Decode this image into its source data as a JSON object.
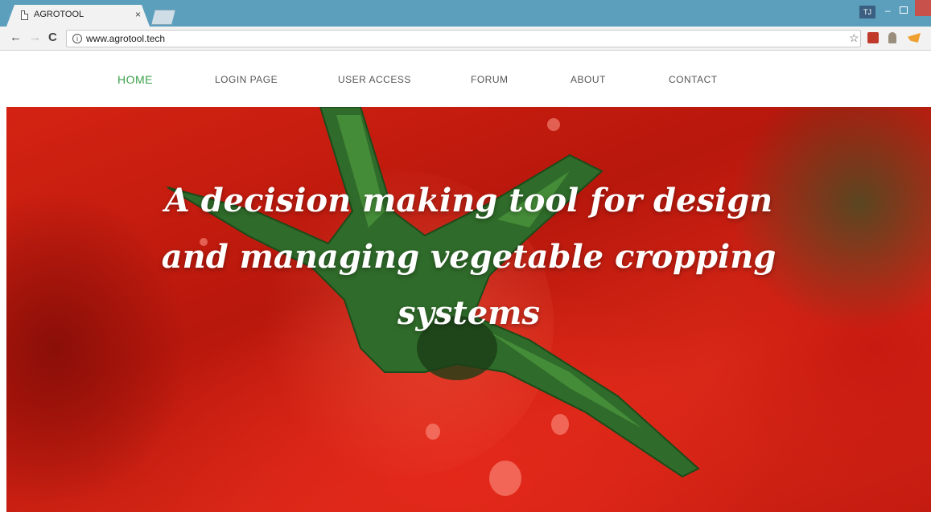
{
  "browser": {
    "tab_title": "AGROTOOL",
    "tab_close": "×",
    "url": "www.agrotool.tech",
    "profile_initials": "TJ",
    "info_glyph": "i",
    "star_glyph": "☆",
    "back_glyph": "←",
    "forward_glyph": "→",
    "reload_glyph": "C",
    "minimize_glyph": "–"
  },
  "nav": {
    "items": [
      {
        "label": "HOME",
        "active": true
      },
      {
        "label": "LOGIN PAGE",
        "active": false
      },
      {
        "label": "USER ACCESS",
        "active": false
      },
      {
        "label": "FORUM",
        "active": false
      },
      {
        "label": "ABOUT",
        "active": false
      },
      {
        "label": "CONTACT",
        "active": false
      }
    ],
    "active_color": "#3aa04a"
  },
  "hero": {
    "heading_lines": [
      "A decision making tool for design",
      "and managing vegetable cropping",
      "systems"
    ]
  },
  "colors": {
    "tabstrip": "#5b9fbd",
    "hero_red": "#d42313",
    "stem_green": "#2f6b2a"
  }
}
